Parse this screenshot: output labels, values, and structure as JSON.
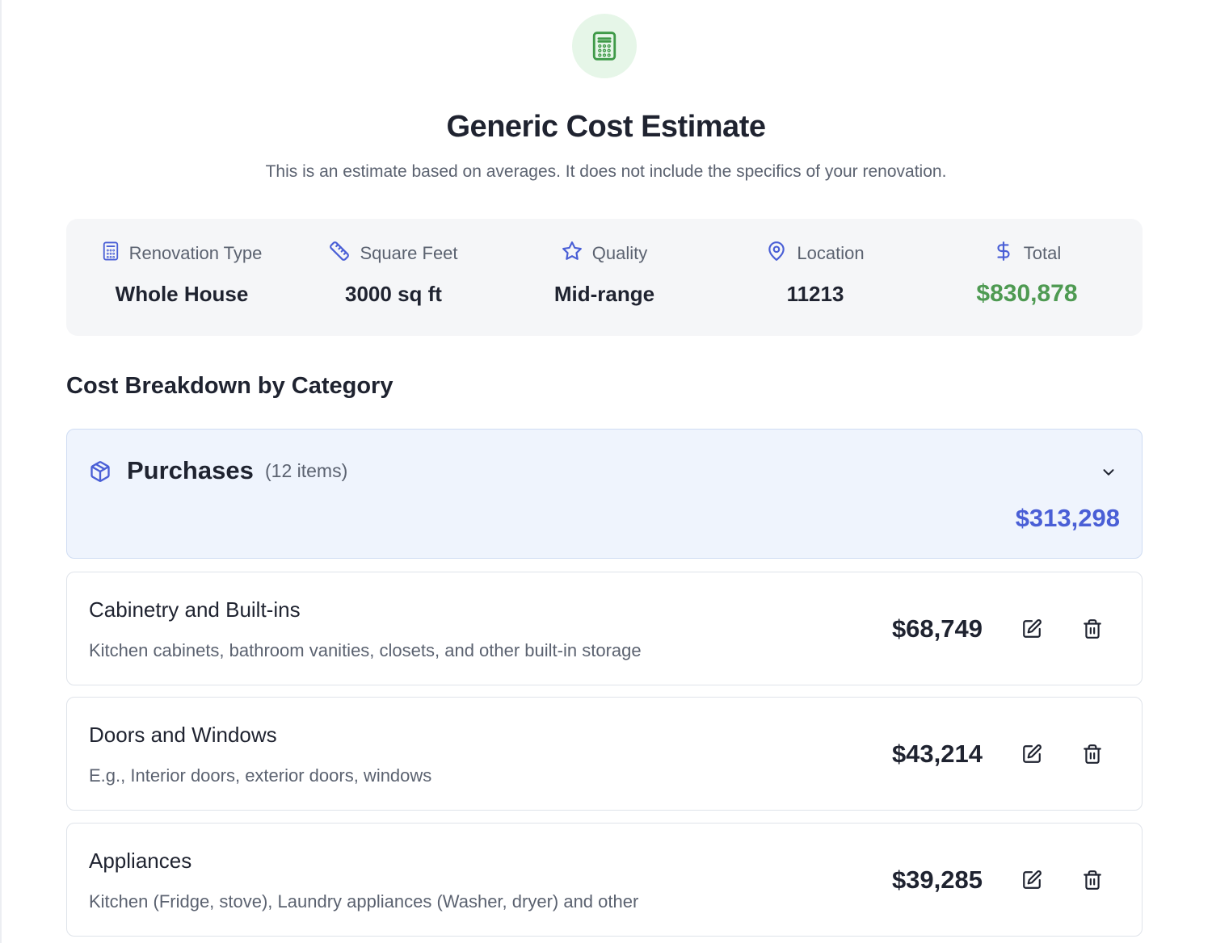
{
  "header": {
    "icon": "calculator-icon",
    "title": "Generic Cost Estimate",
    "subtitle": "This is an estimate based on averages. It does not include the specifics of your renovation."
  },
  "summary": {
    "renovation_type": {
      "icon": "calculator-icon",
      "label": "Renovation Type",
      "value": "Whole House"
    },
    "square_feet": {
      "icon": "ruler-icon",
      "label": "Square Feet",
      "value": "3000 sq ft"
    },
    "quality": {
      "icon": "star-icon",
      "label": "Quality",
      "value": "Mid-range"
    },
    "location": {
      "icon": "map-pin-icon",
      "label": "Location",
      "value": "11213"
    },
    "total": {
      "icon": "dollar-sign-icon",
      "label": "Total",
      "value": "$830,878"
    }
  },
  "breakdown": {
    "heading": "Cost Breakdown by Category",
    "category": {
      "icon": "package-icon",
      "name": "Purchases",
      "count": "(12 items)",
      "total": "$313,298"
    },
    "items": [
      {
        "name": "Cabinetry and Built-ins",
        "description": "Kitchen cabinets, bathroom vanities, closets, and other built-in storage",
        "amount": "$68,749"
      },
      {
        "name": "Doors and Windows",
        "description": "E.g., Interior doors, exterior doors, windows",
        "amount": "$43,214"
      },
      {
        "name": "Appliances",
        "description": "Kitchen (Fridge, stove), Laundry appliances (Washer, dryer) and other",
        "amount": "$39,285"
      }
    ]
  },
  "colors": {
    "accent_green": "#4e9a52",
    "accent_blue": "#4a5fd6",
    "icon_blue": "#4a5fd6",
    "category_bg": "#eff4fd"
  }
}
